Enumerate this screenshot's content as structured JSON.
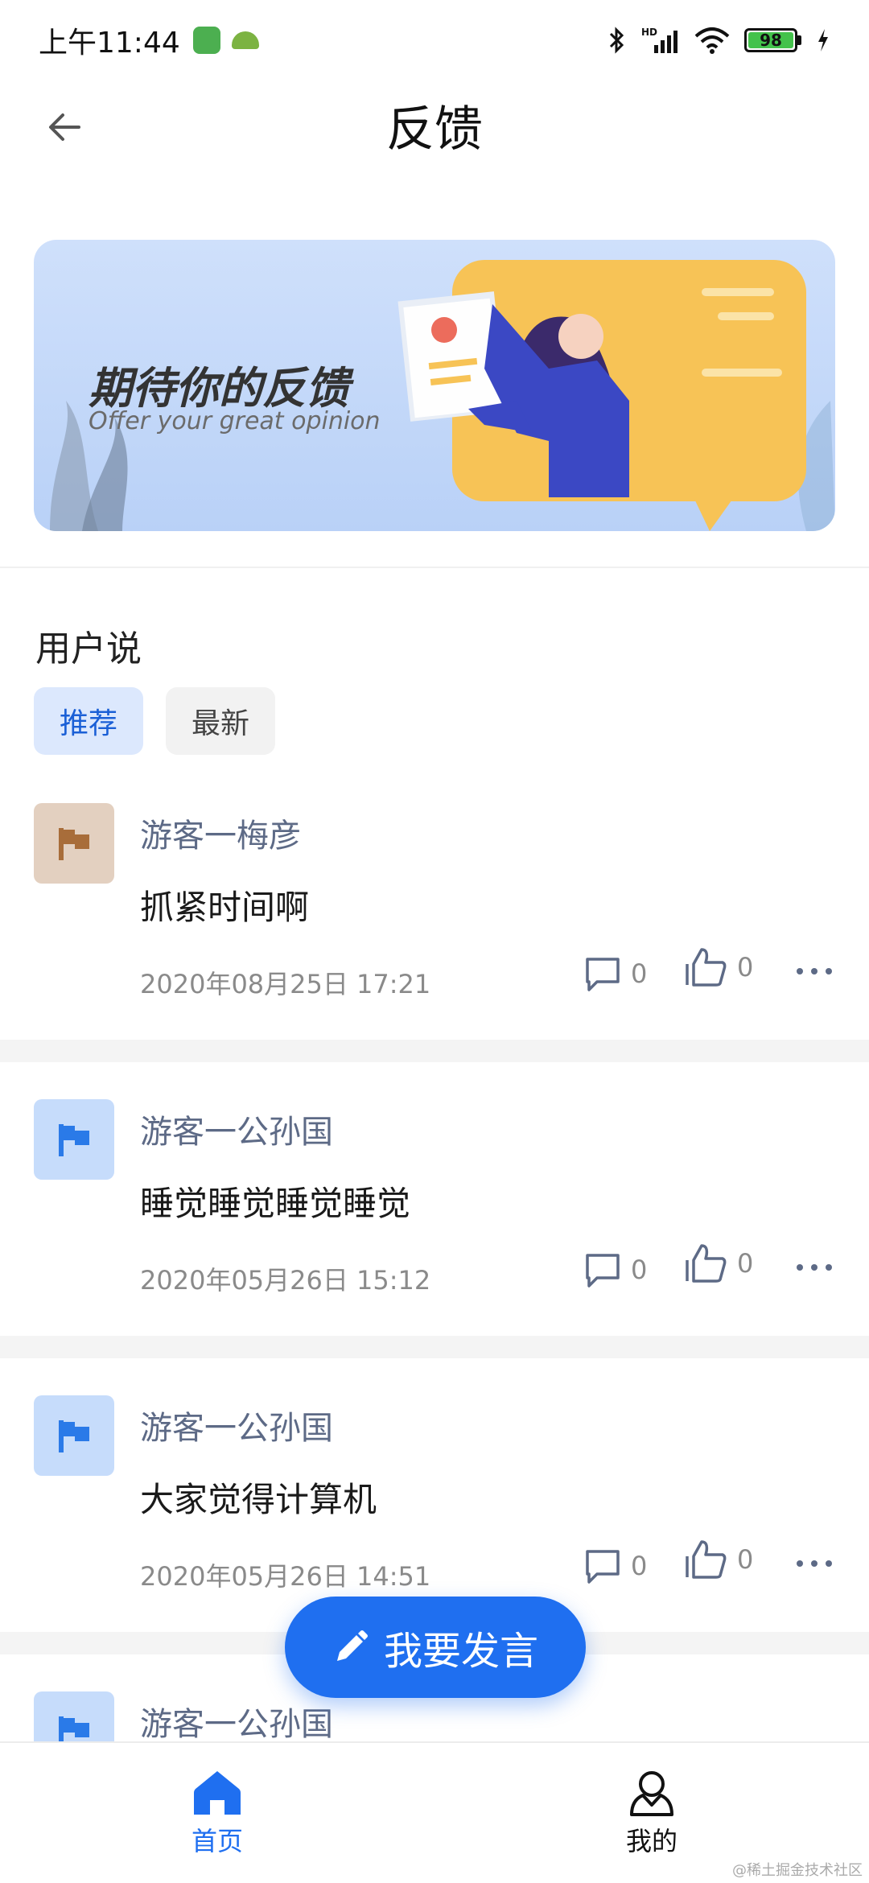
{
  "status_bar": {
    "time": "上午11:44",
    "battery": "98"
  },
  "header": {
    "title": "反馈"
  },
  "banner": {
    "title": "期待你的反馈",
    "subtitle": "Offer your great opinion"
  },
  "section": {
    "title": "用户说",
    "tabs": [
      {
        "label": "推荐",
        "active": true
      },
      {
        "label": "最新",
        "active": false
      }
    ]
  },
  "posts": [
    {
      "user": "游客一梅彦",
      "content": "抓紧时间啊",
      "time": "2020年08月25日 17:21",
      "comments": "0",
      "likes": "0",
      "avatar_bg": "#e3d0c0",
      "avatar_flag": "#a86d3a"
    },
    {
      "user": "游客一公孙国",
      "content": "睡觉睡觉睡觉睡觉",
      "time": "2020年05月26日 15:12",
      "comments": "0",
      "likes": "0",
      "avatar_bg": "#c6dcfb",
      "avatar_flag": "#2a7ae8"
    },
    {
      "user": "游客一公孙国",
      "content": "大家觉得计算机",
      "time": "2020年05月26日 14:51",
      "comments": "0",
      "likes": "0",
      "avatar_bg": "#c6dcfb",
      "avatar_flag": "#2a7ae8"
    },
    {
      "user": "游客一公孙国",
      "avatar_bg": "#c6dcfb",
      "avatar_flag": "#2a7ae8"
    }
  ],
  "fab": {
    "label": "我要发言"
  },
  "bottom_nav": {
    "home": "首页",
    "me": "我的"
  },
  "watermark": "@稀土掘金技术社区",
  "colors": {
    "accent": "#1f6ff0",
    "username": "#5d6a86"
  }
}
